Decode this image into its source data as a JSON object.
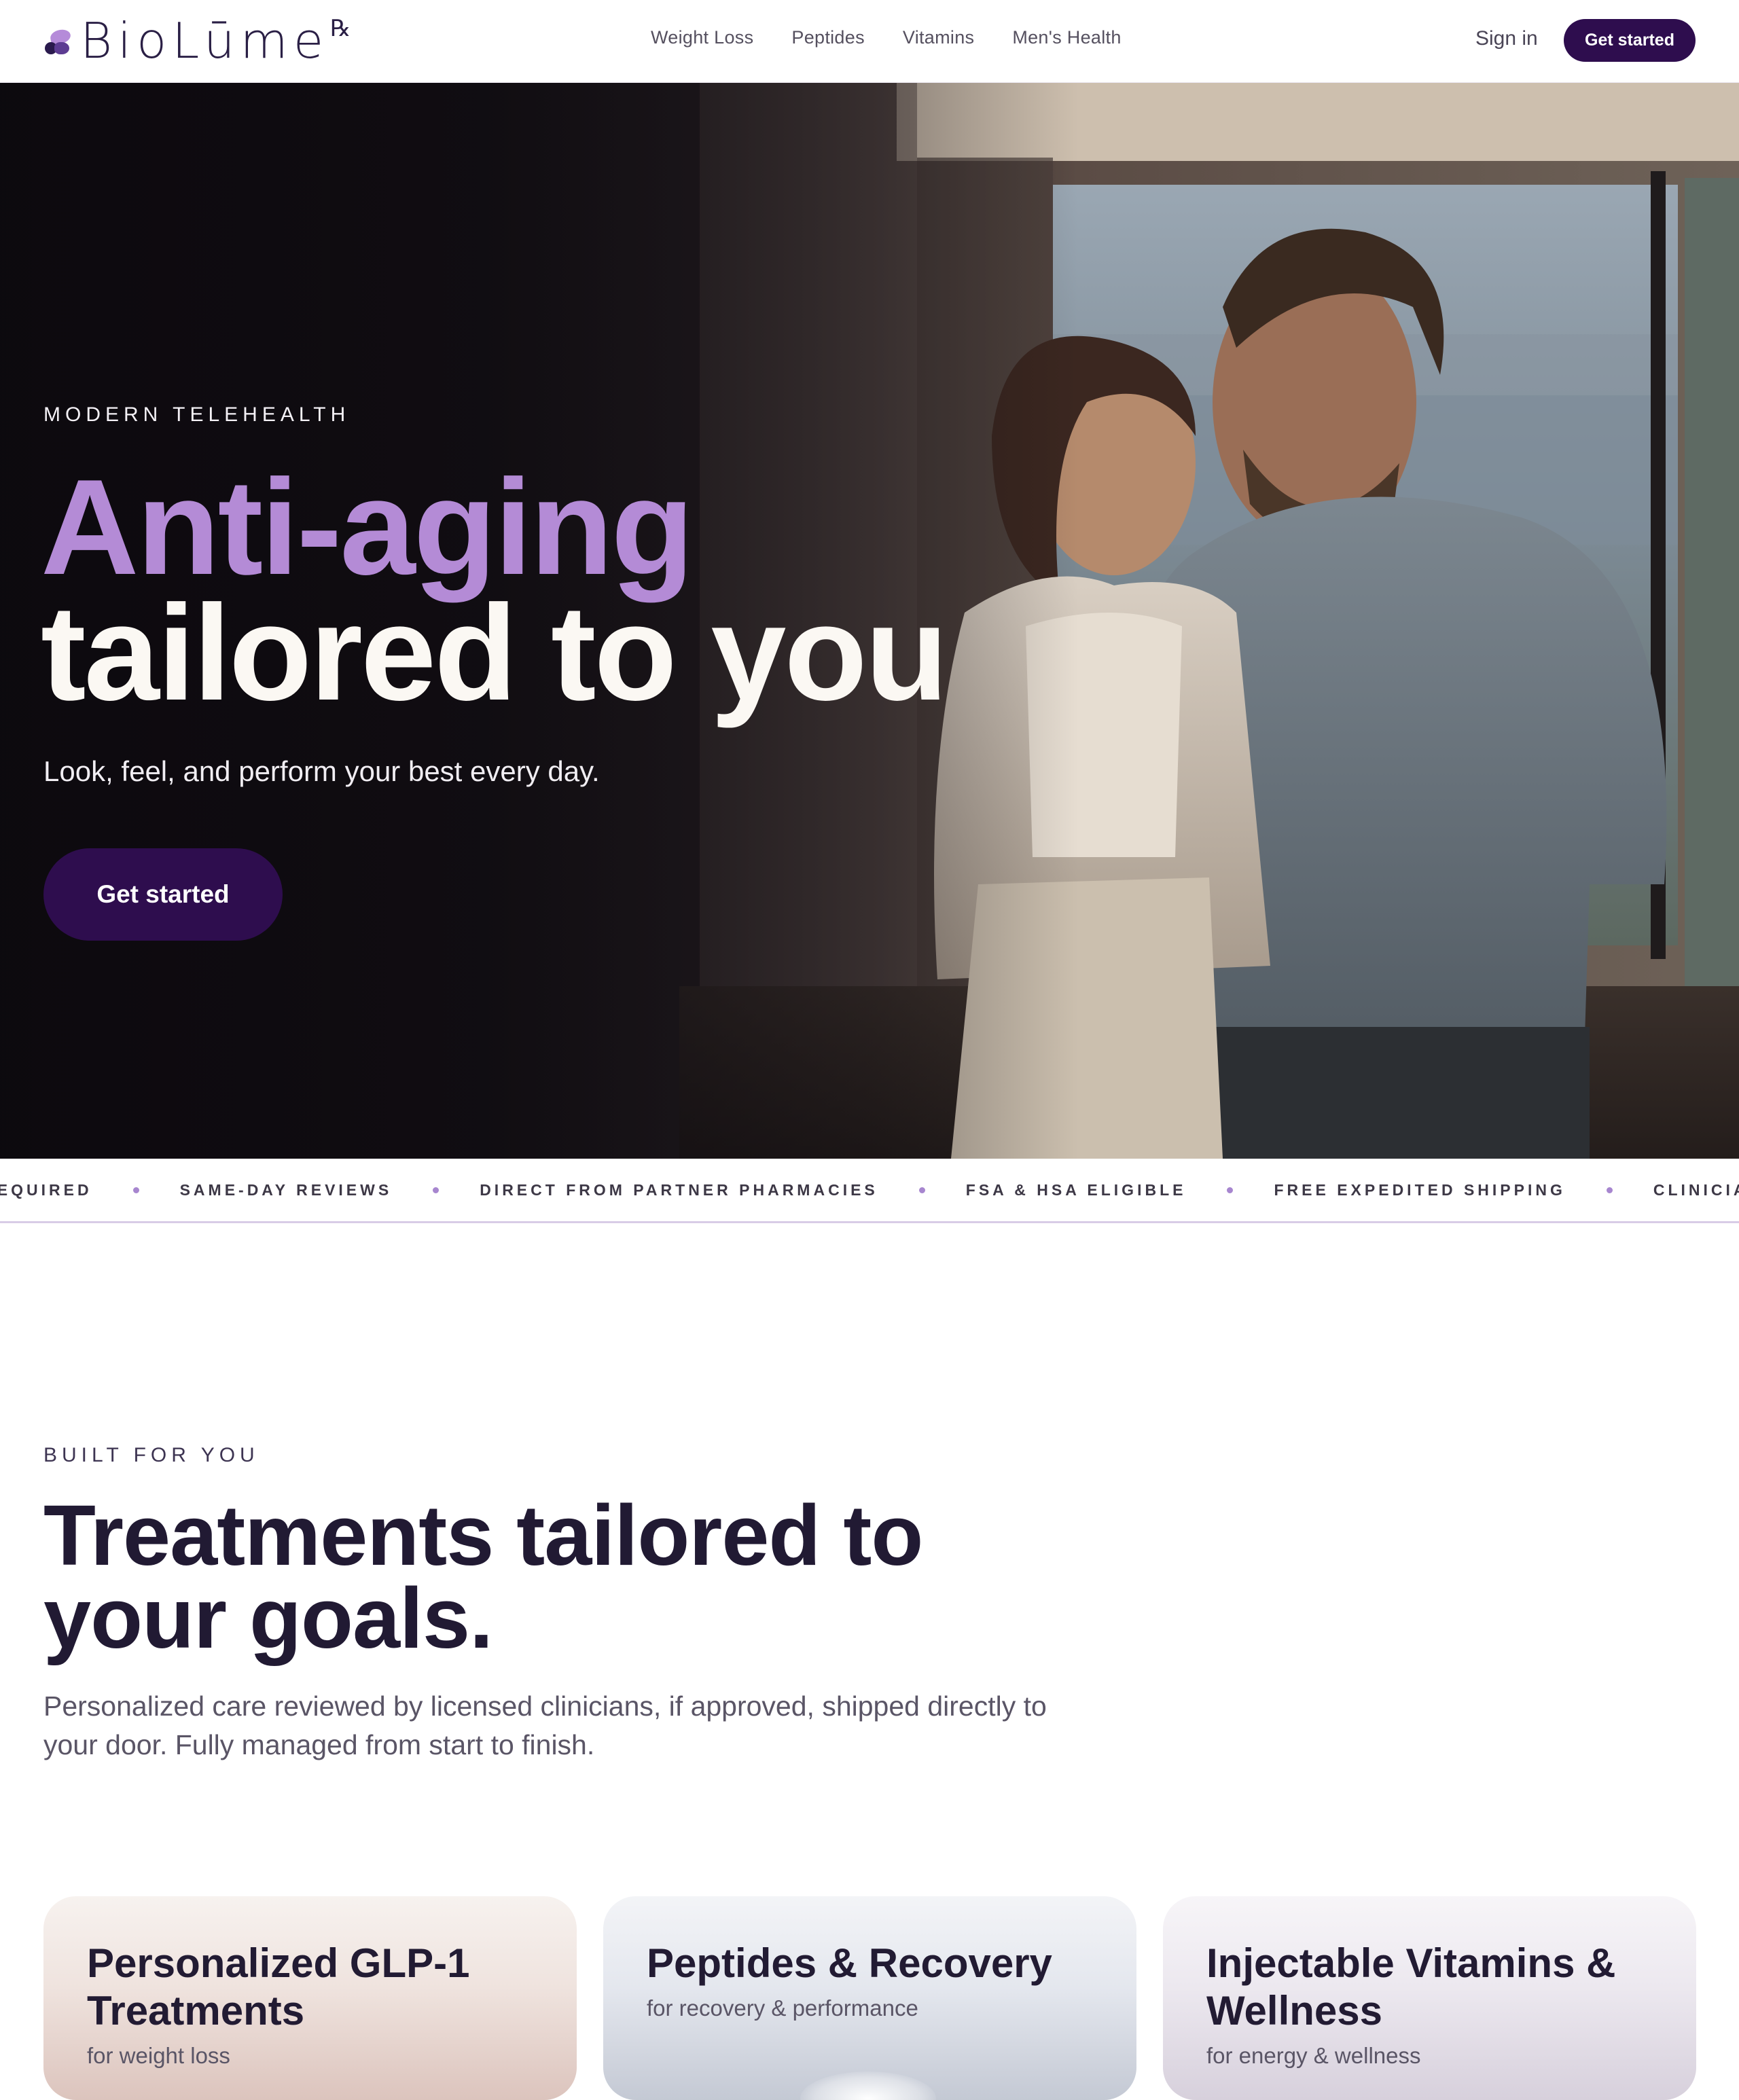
{
  "header": {
    "logo_text": "BioLūme",
    "logo_rx": "℞",
    "nav": [
      "Weight Loss",
      "Peptides",
      "Vitamins",
      "Men's Health"
    ],
    "sign_in": "Sign in",
    "cta": "Get started"
  },
  "hero": {
    "eyebrow": "MODERN TELEHEALTH",
    "title_accent": "Anti-aging",
    "title_rest": "tailored to you",
    "subtitle": "Look, feel, and perform your best every day.",
    "cta": "Get started"
  },
  "ticker": [
    "RANCE REQUIRED",
    "SAME-DAY REVIEWS",
    "DIRECT FROM PARTNER PHARMACIES",
    "FSA & HSA ELIGIBLE",
    "FREE EXPEDITED SHIPPING",
    "CLINICIAN"
  ],
  "section": {
    "eyebrow": "BUILT FOR YOU",
    "title": "Treatments tailored to your goals.",
    "description": "Personalized care reviewed by licensed clinicians, if approved, shipped directly to your door. Fully managed from start to finish."
  },
  "cards": [
    {
      "title": "Personalized GLP-1 Treatments",
      "subtitle": "for weight loss"
    },
    {
      "title": "Peptides & Recovery",
      "subtitle": "for recovery & performance"
    },
    {
      "title": "Injectable Vitamins & Wellness",
      "subtitle": "for energy & wellness"
    }
  ],
  "colors": {
    "brand_dark": "#2e0d4e",
    "accent_lavender": "#b48bd6",
    "text_dark": "#211a33"
  }
}
